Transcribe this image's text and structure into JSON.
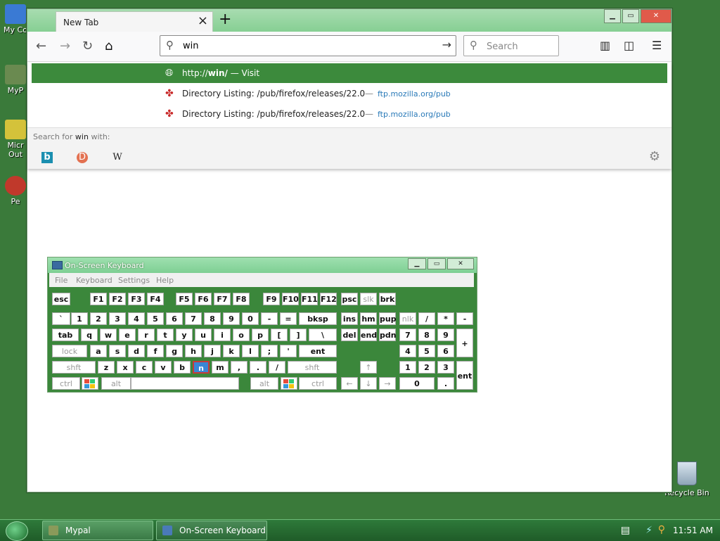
{
  "desktop": {
    "icons": [
      {
        "label": "My Co",
        "color": "#3a7ad4"
      },
      {
        "label": "MyP",
        "color": "#6a8a50"
      },
      {
        "label": "Micr Out",
        "color": "#d4c23a"
      },
      {
        "label": "Pe",
        "color": "#c0392b"
      }
    ],
    "recycle_bin": "Recycle Bin"
  },
  "browser": {
    "tab_title": "New Tab",
    "url_value": "win",
    "search_placeholder": "Search",
    "suggestions": [
      {
        "prefix": "http://",
        "bold": "win/",
        "suffix": " — Visit",
        "selected": true,
        "icon": "globe-icon"
      },
      {
        "title": "Directory Listing: /pub/firefox/releases/22.0",
        "url": "ftp.mozilla.org/pub",
        "selected": false,
        "icon": "ftp-icon"
      },
      {
        "title": "Directory Listing: /pub/firefox/releases/22.0",
        "url": "ftp.mozilla.org/pub",
        "selected": false,
        "icon": "ftp-icon"
      }
    ],
    "search_for_label": "Search for ",
    "search_for_term": "win",
    "search_for_suffix": " with:",
    "engines": [
      "b",
      "D",
      "W"
    ]
  },
  "osk": {
    "title": "On-Screen Keyboard",
    "menu": [
      "File",
      "Keyboard",
      "Settings",
      "Help"
    ],
    "keys": [
      [
        "esc",
        "F1",
        "F2",
        "F3",
        "F4",
        "F5",
        "F6",
        "F7",
        "F8",
        "F9",
        "F10",
        "F11",
        "F12",
        "psc",
        "slk",
        "brk"
      ],
      [
        "`",
        "1",
        "2",
        "3",
        "4",
        "5",
        "6",
        "7",
        "8",
        "9",
        "0",
        "-",
        "=",
        "bksp",
        "ins",
        "hm",
        "pup",
        "nlk",
        "/",
        "*",
        "-"
      ],
      [
        "tab",
        "q",
        "w",
        "e",
        "r",
        "t",
        "y",
        "u",
        "i",
        "o",
        "p",
        "[",
        "]",
        "\\",
        "del",
        "end",
        "pdn",
        "7",
        "8",
        "9",
        "+"
      ],
      [
        "lock",
        "a",
        "s",
        "d",
        "f",
        "g",
        "h",
        "j",
        "k",
        "l",
        ";",
        "'",
        "ent",
        "4",
        "5",
        "6"
      ],
      [
        "shft",
        "z",
        "x",
        "c",
        "v",
        "b",
        "n",
        "m",
        ",",
        ".",
        "/",
        "shft",
        "↑",
        "1",
        "2",
        "3",
        "ent"
      ],
      [
        "ctrl",
        "alt",
        "alt",
        "ctrl",
        "←",
        "↓",
        "→",
        "0",
        "."
      ]
    ]
  },
  "taskbar": {
    "items": [
      "Mypal",
      "On-Screen Keyboard"
    ],
    "time": "11:51 AM"
  }
}
